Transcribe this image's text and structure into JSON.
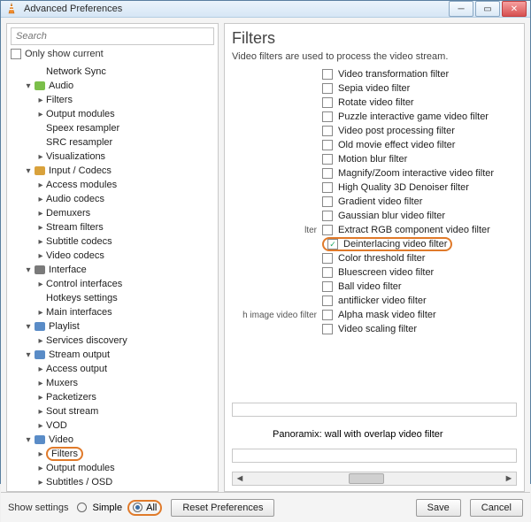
{
  "window": {
    "title": "Advanced Preferences"
  },
  "left": {
    "search_placeholder": "Search",
    "only_show_current": "Only show current",
    "tree": [
      {
        "indent": 2,
        "exp": "",
        "icon": "",
        "label": "Network Sync"
      },
      {
        "indent": 1,
        "exp": "▾",
        "icon": "audio",
        "label": "Audio"
      },
      {
        "indent": 2,
        "exp": "▸",
        "icon": "",
        "label": "Filters"
      },
      {
        "indent": 2,
        "exp": "▸",
        "icon": "",
        "label": "Output modules"
      },
      {
        "indent": 2,
        "exp": "",
        "icon": "",
        "label": "Speex resampler"
      },
      {
        "indent": 2,
        "exp": "",
        "icon": "",
        "label": "SRC resampler"
      },
      {
        "indent": 2,
        "exp": "▸",
        "icon": "",
        "label": "Visualizations"
      },
      {
        "indent": 1,
        "exp": "▾",
        "icon": "codec",
        "label": "Input / Codecs"
      },
      {
        "indent": 2,
        "exp": "▸",
        "icon": "",
        "label": "Access modules"
      },
      {
        "indent": 2,
        "exp": "▸",
        "icon": "",
        "label": "Audio codecs"
      },
      {
        "indent": 2,
        "exp": "▸",
        "icon": "",
        "label": "Demuxers"
      },
      {
        "indent": 2,
        "exp": "▸",
        "icon": "",
        "label": "Stream filters"
      },
      {
        "indent": 2,
        "exp": "▸",
        "icon": "",
        "label": "Subtitle codecs"
      },
      {
        "indent": 2,
        "exp": "▸",
        "icon": "",
        "label": "Video codecs"
      },
      {
        "indent": 1,
        "exp": "▾",
        "icon": "iface",
        "label": "Interface"
      },
      {
        "indent": 2,
        "exp": "▸",
        "icon": "",
        "label": "Control interfaces"
      },
      {
        "indent": 2,
        "exp": "",
        "icon": "",
        "label": "Hotkeys settings"
      },
      {
        "indent": 2,
        "exp": "▸",
        "icon": "",
        "label": "Main interfaces"
      },
      {
        "indent": 1,
        "exp": "▾",
        "icon": "plist",
        "label": "Playlist"
      },
      {
        "indent": 2,
        "exp": "▸",
        "icon": "",
        "label": "Services discovery"
      },
      {
        "indent": 1,
        "exp": "▾",
        "icon": "sout",
        "label": "Stream output"
      },
      {
        "indent": 2,
        "exp": "▸",
        "icon": "",
        "label": "Access output"
      },
      {
        "indent": 2,
        "exp": "▸",
        "icon": "",
        "label": "Muxers"
      },
      {
        "indent": 2,
        "exp": "▸",
        "icon": "",
        "label": "Packetizers"
      },
      {
        "indent": 2,
        "exp": "▸",
        "icon": "",
        "label": "Sout stream"
      },
      {
        "indent": 2,
        "exp": "▸",
        "icon": "",
        "label": "VOD"
      },
      {
        "indent": 1,
        "exp": "▾",
        "icon": "video",
        "label": "Video"
      },
      {
        "indent": 2,
        "exp": "▸",
        "icon": "",
        "label": "Filters",
        "highlight": true
      },
      {
        "indent": 2,
        "exp": "▸",
        "icon": "",
        "label": "Output modules"
      },
      {
        "indent": 2,
        "exp": "▸",
        "icon": "",
        "label": "Subtitles / OSD"
      }
    ]
  },
  "right": {
    "heading": "Filters",
    "description": "Video filters are used to process the video stream.",
    "filters": [
      {
        "lhs": "",
        "label": "Video transformation filter",
        "checked": false
      },
      {
        "lhs": "",
        "label": "Sepia video filter",
        "checked": false
      },
      {
        "lhs": "",
        "label": "Rotate video filter",
        "checked": false
      },
      {
        "lhs": "",
        "label": "Puzzle interactive game video filter",
        "checked": false
      },
      {
        "lhs": "",
        "label": "Video post processing filter",
        "checked": false
      },
      {
        "lhs": "",
        "label": "Old movie effect video filter",
        "checked": false
      },
      {
        "lhs": "",
        "label": "Motion blur filter",
        "checked": false
      },
      {
        "lhs": "",
        "label": "Magnify/Zoom interactive video filter",
        "checked": false
      },
      {
        "lhs": "",
        "label": "High Quality 3D Denoiser filter",
        "checked": false
      },
      {
        "lhs": "",
        "label": "Gradient video filter",
        "checked": false
      },
      {
        "lhs": "",
        "label": "Gaussian blur video filter",
        "checked": false
      },
      {
        "lhs": "lter",
        "label": "Extract RGB component video filter",
        "checked": false
      },
      {
        "lhs": "",
        "label": "Deinterlacing video filter",
        "checked": true,
        "highlight": true
      },
      {
        "lhs": "",
        "label": "Color threshold filter",
        "checked": false
      },
      {
        "lhs": "",
        "label": "Bluescreen video filter",
        "checked": false
      },
      {
        "lhs": "",
        "label": "Ball video filter",
        "checked": false
      },
      {
        "lhs": "",
        "label": "antiflicker video filter",
        "checked": false
      },
      {
        "lhs": "h image video filter",
        "label": "Alpha mask video filter",
        "checked": false
      },
      {
        "lhs": "",
        "label": "Video scaling filter",
        "checked": false
      }
    ],
    "panoramix": "Panoramix: wall with overlap video filter"
  },
  "footer": {
    "show_settings": "Show settings",
    "simple": "Simple",
    "all": "All",
    "reset": "Reset Preferences",
    "save": "Save",
    "cancel": "Cancel"
  },
  "icons": {
    "audio": "#7bbf4a",
    "codec": "#d9a23c",
    "iface": "#7a7a7a",
    "plist": "#5a8cc7",
    "sout": "#5a8cc7",
    "video": "#5a8cc7"
  }
}
